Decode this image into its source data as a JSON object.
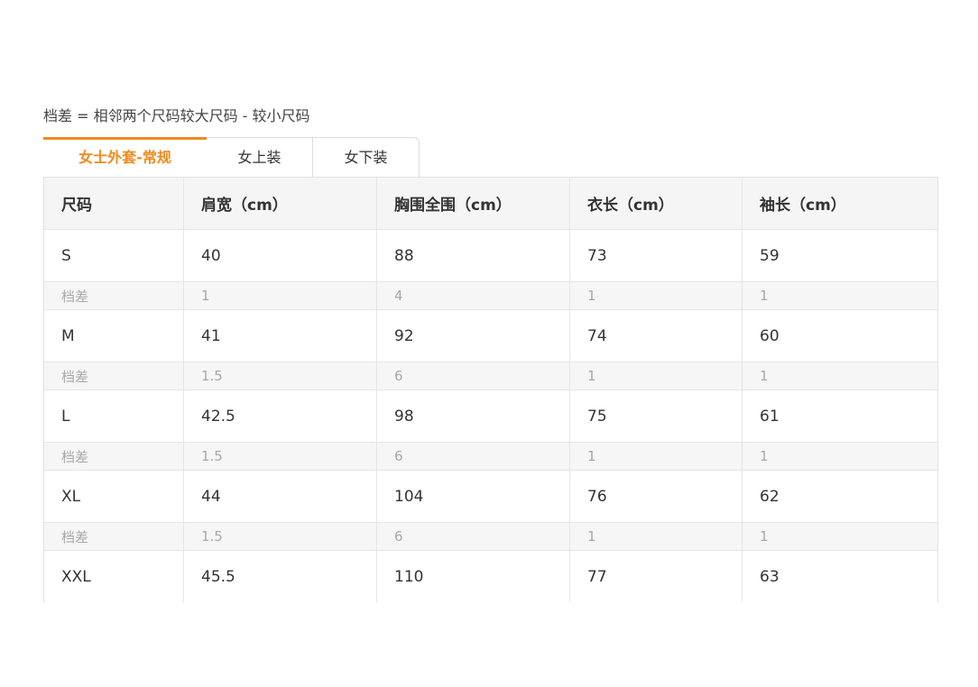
{
  "note": "档差 = 相邻两个尺码较大尺码 - 较小尺码",
  "accent_color": "#f08a1c",
  "tabs": [
    {
      "label": "女士外套-常规",
      "active": true
    },
    {
      "label": "女上装",
      "active": false
    },
    {
      "label": "女下装",
      "active": false
    }
  ],
  "table": {
    "headers": [
      "尺码",
      "肩宽（cm）",
      "胸围全围（cm）",
      "衣长（cm）",
      "袖长（cm）"
    ],
    "rows": [
      [
        "S",
        "40",
        "88",
        "73",
        "59"
      ],
      [
        "档差",
        "1",
        "4",
        "1",
        "1"
      ],
      [
        "M",
        "41",
        "92",
        "74",
        "60"
      ],
      [
        "档差",
        "1.5",
        "6",
        "1",
        "1"
      ],
      [
        "L",
        "42.5",
        "98",
        "75",
        "61"
      ],
      [
        "档差",
        "1.5",
        "6",
        "1",
        "1"
      ],
      [
        "XL",
        "44",
        "104",
        "76",
        "62"
      ],
      [
        "档差",
        "1.5",
        "6",
        "1",
        "1"
      ],
      [
        "XXL",
        "45.5",
        "110",
        "77",
        "63"
      ]
    ]
  }
}
